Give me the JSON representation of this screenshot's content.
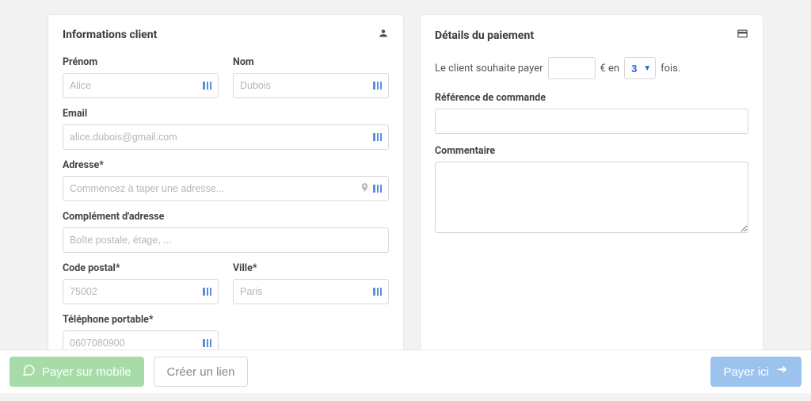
{
  "client_card": {
    "title": "Informations client",
    "fields": {
      "firstname_label": "Prénom",
      "firstname_placeholder": "Alice",
      "lastname_label": "Nom",
      "lastname_placeholder": "Dubois",
      "email_label": "Email",
      "email_placeholder": "alice.dubois@gmail.com",
      "address_label": "Adresse*",
      "address_placeholder": "Commencez à taper une adresse...",
      "address2_label": "Complément d'adresse",
      "address2_placeholder": "Boîte postale, étage, ...",
      "postcode_label": "Code postal*",
      "postcode_placeholder": "75002",
      "city_label": "Ville*",
      "city_placeholder": "Paris",
      "phone_label": "Téléphone portable*",
      "phone_placeholder": "0607080900"
    }
  },
  "payment_card": {
    "title": "Détails du paiement",
    "line_prefix": "Le client souhaite payer",
    "currency_in": "€ en",
    "installments_value": "3",
    "line_suffix": "fois.",
    "reference_label": "Référence de commande",
    "comment_label": "Commentaire"
  },
  "footer": {
    "pay_mobile": "Payer sur mobile",
    "create_link": "Créer un lien",
    "pay_here": "Payer ici"
  }
}
